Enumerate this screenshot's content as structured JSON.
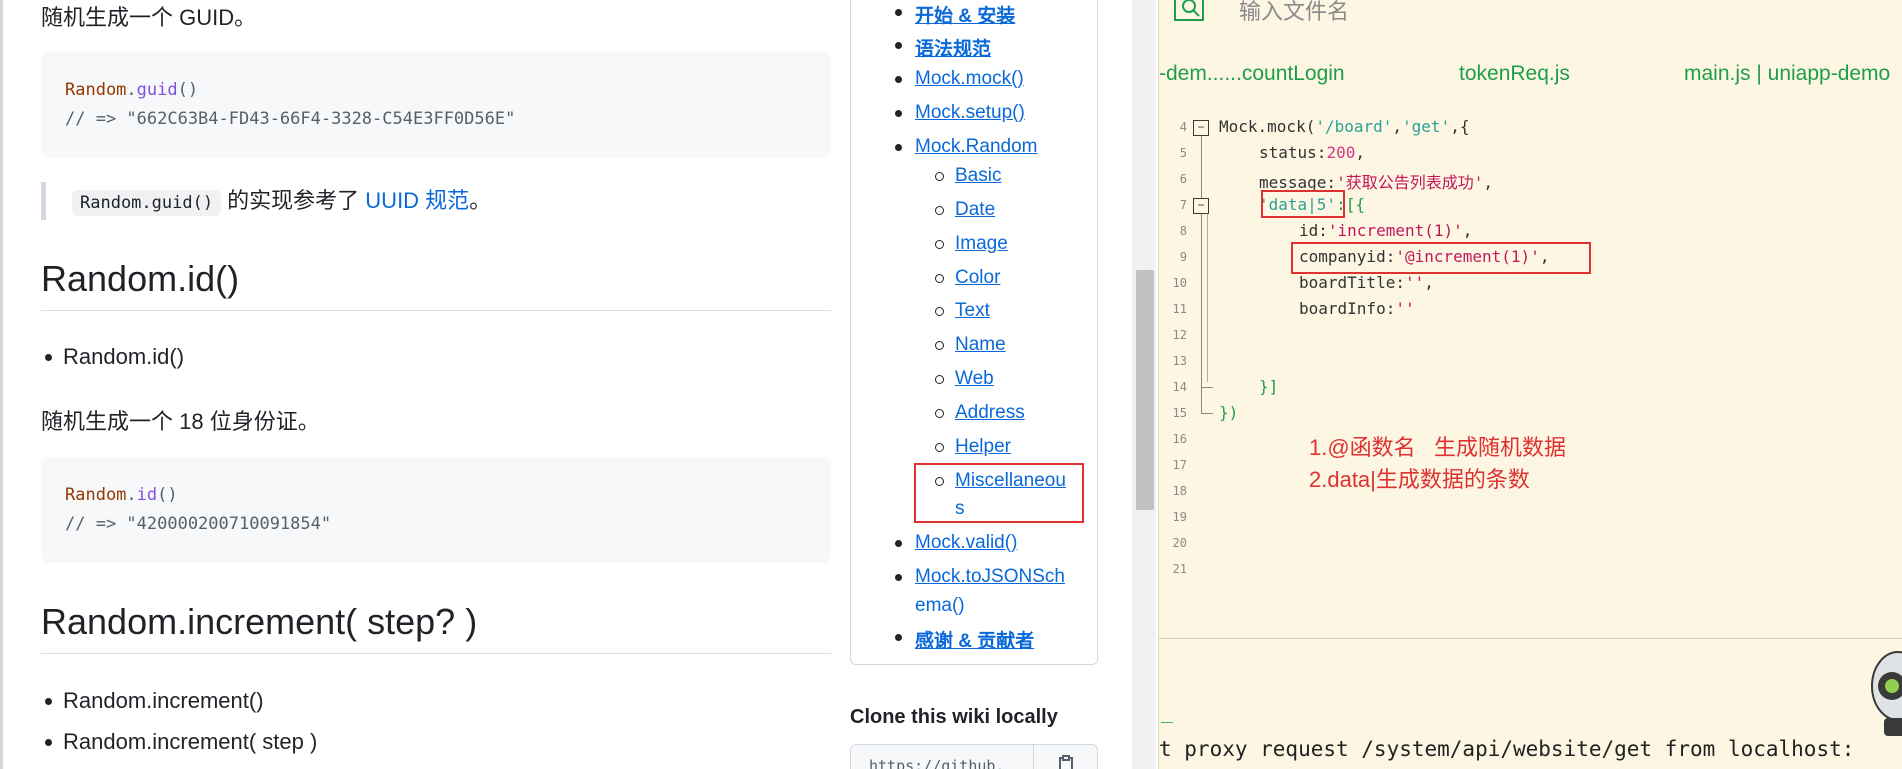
{
  "wiki": {
    "guid_desc": "随机生成一个 GUID。",
    "guid_code_obj": "Random",
    "guid_code_fn": "guid",
    "guid_code_call_suffix": "()",
    "guid_result": "// => \"662C63B4-FD43-66F4-3328-C54E3FF0D56E\"",
    "quote_code": "Random.guid()",
    "quote_text": " 的实现参考了 ",
    "quote_link": "UUID 规范",
    "quote_end": "。",
    "id_heading": "Random.id()",
    "id_bullet": "Random.id()",
    "id_desc": "随机生成一个 18 位身份证。",
    "id_code_obj": "Random",
    "id_code_fn": "id",
    "id_code_call_suffix": "()",
    "id_result": "// => \"420000200710091854\"",
    "inc_heading": "Random.increment( step? )",
    "inc_bullet_1": "Random.increment()",
    "inc_bullet_2": "Random.increment( step )"
  },
  "toc": {
    "top_items": [
      "开始 & 安装",
      "语法规范",
      "Mock.mock()",
      "Mock.setup()",
      "Mock.Random"
    ],
    "random_items": [
      "Basic",
      "Date",
      "Image",
      "Color",
      "Text",
      "Name",
      "Web",
      "Address",
      "Helper"
    ],
    "misc_line1": "Miscellaneou",
    "misc_line2": "s",
    "bottom_items": [
      "Mock.valid()",
      "Mock.toJSONSch",
      "ema()",
      "感谢 & 贡献者"
    ],
    "clone_title": "Clone this wiki locally",
    "clone_input": "https://github."
  },
  "editor": {
    "search_placeholder": "输入文件名",
    "tabs": [
      "-dem......countLogin",
      "tokenReq.js",
      "main.js | uniapp-demo"
    ],
    "line_numbers": [
      "4",
      "5",
      "6",
      "7",
      "8",
      "9",
      "10",
      "11",
      "12",
      "13",
      "14",
      "15",
      "16",
      "17",
      "18",
      "19",
      "20",
      "21"
    ],
    "code": {
      "l4_a": "Mock.mock(",
      "l4_b": "'/board'",
      "l4_c": ",",
      "l4_d": "'get'",
      "l4_e": ",{",
      "l5_a": "status:",
      "l5_b": "200",
      "l5_c": ",",
      "l6_a": "message:",
      "l6_b": "'获取公告列表成功'",
      "l6_c": ",",
      "l7_a": "'data|5'",
      "l7_b": ":[{",
      "l8_a": "id:",
      "l8_b": "'increment(1)'",
      "l8_c": ",",
      "l9_a": "companyid:",
      "l9_b": "'@increment(1)'",
      "l9_c": ",",
      "l10_a": "boardTitle:",
      "l10_b": "''",
      "l10_c": ",",
      "l11_a": "boardInfo:",
      "l11_b": "''",
      "l14": "}]",
      "l15": "})"
    },
    "note_1": "1.@函数名   生成随机数据",
    "note_2": "2.data|生成数据的条数",
    "terminal_line": "t proxy request /system/api/website/get from localhost:"
  },
  "colors": {
    "link": "#0969da",
    "annotation_red": "#e03131",
    "editor_bg": "#fdf6e3",
    "editor_green": "#1e9e4b"
  }
}
